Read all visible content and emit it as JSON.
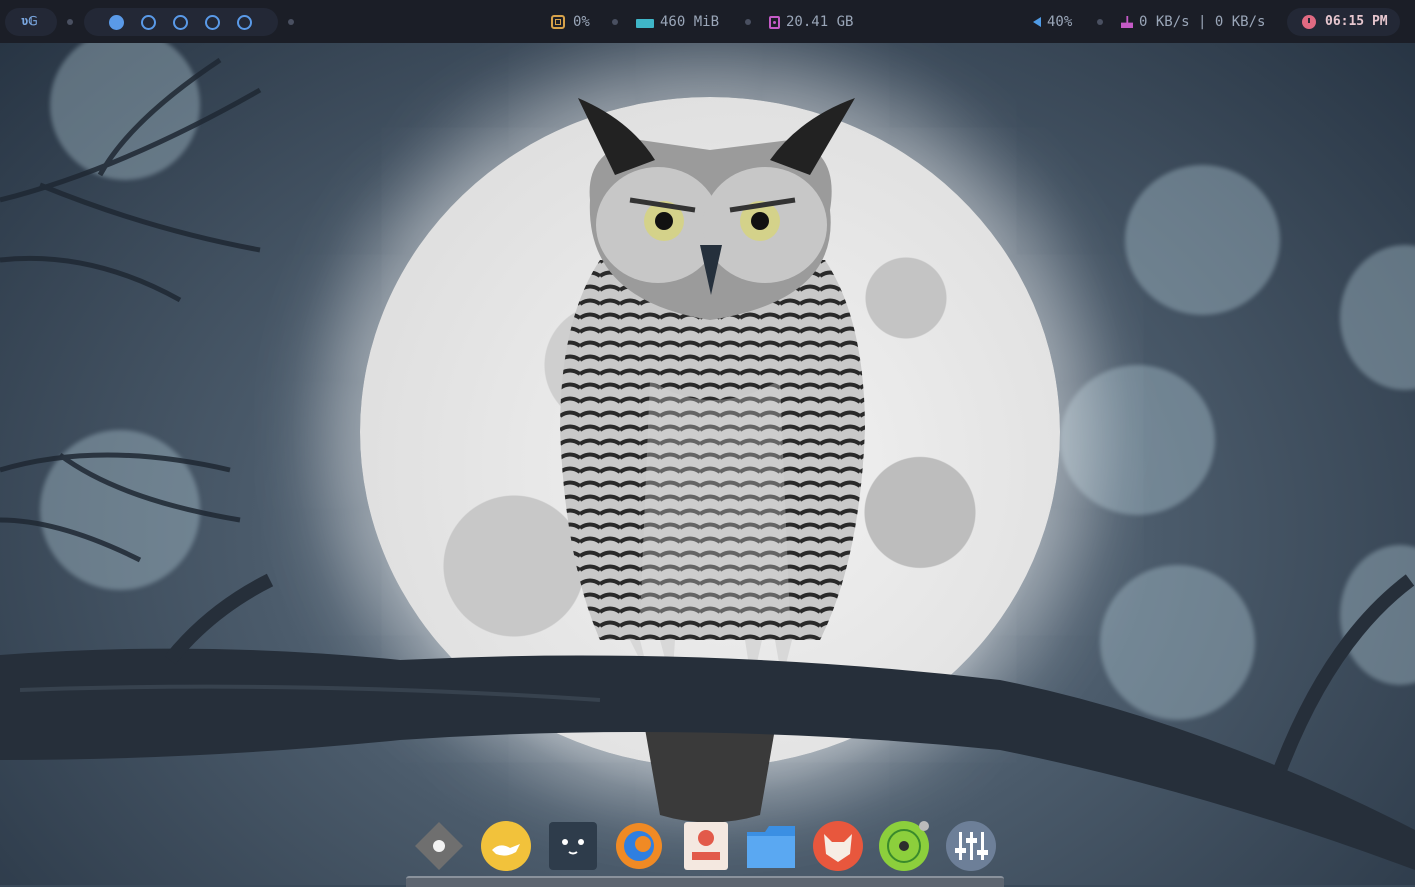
{
  "topbar": {
    "logo_text": "ʋ𝔾",
    "workspaces": [
      {
        "id": 1,
        "active": true
      },
      {
        "id": 2,
        "active": false
      },
      {
        "id": 3,
        "active": false
      },
      {
        "id": 4,
        "active": false
      },
      {
        "id": 5,
        "active": false
      }
    ],
    "cpu": "0%",
    "memory": "460 MiB",
    "disk": "20.41 GB",
    "volume": "40%",
    "network": "0 KB/s | 0 KB/s",
    "clock": "06:15 PM",
    "colors": {
      "bar_bg": "#1b1e27",
      "pill_bg": "#232836",
      "workspace": "#5a9ae8",
      "cpu": "#d7a24a",
      "memory": "#3fb6c8",
      "disk": "#c45ac6",
      "volume": "#4f9be6",
      "network": "#c45ac6",
      "clock": "#e06a82"
    }
  },
  "dock": {
    "apps": [
      {
        "name": "app-launcher-icon"
      },
      {
        "name": "genie-lamp-icon"
      },
      {
        "name": "terminal-cat-icon"
      },
      {
        "name": "web-browser-icon"
      },
      {
        "name": "image-viewer-icon"
      },
      {
        "name": "file-manager-icon"
      },
      {
        "name": "fox-browser-icon"
      },
      {
        "name": "music-player-icon"
      },
      {
        "name": "settings-mixer-icon"
      }
    ]
  },
  "wallpaper": {
    "subject": "owl-on-branch-full-moon"
  }
}
